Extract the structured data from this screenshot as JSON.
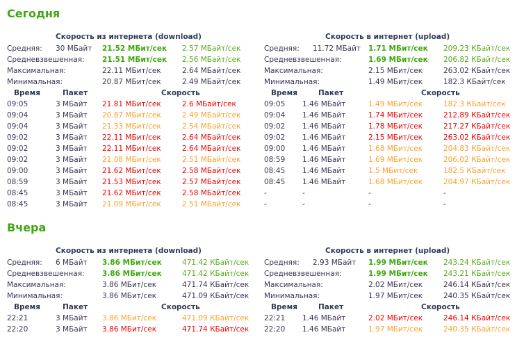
{
  "colors": {
    "title": "#3fa80f",
    "good": "#3fa80f",
    "red": "#f00000",
    "orange": "#f9a12a"
  },
  "days": [
    {
      "title": "Сегодня",
      "download": {
        "heading": "Скорость из интернета (download)",
        "stats": [
          {
            "label": "Средняя:",
            "size": "30 МБайт",
            "mbit": "21.52 МБит/сек",
            "bytes": "2.57 МБайт/сек",
            "style": "good"
          },
          {
            "label": "Средневзвешенная:",
            "size": "",
            "mbit": "21.51 МБит/сек",
            "bytes": "2.56 МБайт/сек",
            "style": "good"
          },
          {
            "label": "Максимальная:",
            "size": "",
            "mbit": "22.11 МБит/сек",
            "bytes": "2.64 МБайт/сек",
            "style": "plain"
          },
          {
            "label": "Минимальная:",
            "size": "",
            "mbit": "20.87 МБит/сек",
            "bytes": "2.49 МБайт/сек",
            "style": "plain"
          }
        ],
        "columns": {
          "time": "Время",
          "packet": "Пакет",
          "speed": "Скорость"
        },
        "rows": [
          {
            "time": "09:05",
            "packet": "3 МБайт",
            "mbit": "21.81 МБит/сек",
            "bytes": "2.6 МБайт/сек",
            "style": "red"
          },
          {
            "time": "09:04",
            "packet": "3 МБайт",
            "mbit": "20.87 МБит/сек",
            "bytes": "2.49 МБайт/сек",
            "style": "orange"
          },
          {
            "time": "09:04",
            "packet": "3 МБайт",
            "mbit": "21.33 МБит/сек",
            "bytes": "2.54 МБайт/сек",
            "style": "orange"
          },
          {
            "time": "09:02",
            "packet": "3 МБайт",
            "mbit": "22.11 МБит/сек",
            "bytes": "2.64 МБайт/сек",
            "style": "red"
          },
          {
            "time": "09:02",
            "packet": "3 МБайт",
            "mbit": "22.11 МБит/сек",
            "bytes": "2.64 МБайт/сек",
            "style": "red"
          },
          {
            "time": "09:02",
            "packet": "3 МБайт",
            "mbit": "21.08 МБит/сек",
            "bytes": "2.51 МБайт/сек",
            "style": "orange"
          },
          {
            "time": "09:00",
            "packet": "3 МБайт",
            "mbit": "21.62 МБит/сек",
            "bytes": "2.58 МБайт/сек",
            "style": "red"
          },
          {
            "time": "08:59",
            "packet": "3 МБайт",
            "mbit": "21.53 МБит/сек",
            "bytes": "2.57 МБайт/сек",
            "style": "red"
          },
          {
            "time": "08:45",
            "packet": "3 МБайт",
            "mbit": "21.62 МБит/сек",
            "bytes": "2.58 МБайт/сек",
            "style": "red"
          },
          {
            "time": "08:45",
            "packet": "3 МБайт",
            "mbit": "21.09 МБит/сек",
            "bytes": "2.51 МБайт/сек",
            "style": "orange"
          }
        ]
      },
      "upload": {
        "heading": "Скорость в интернет (upload)",
        "stats": [
          {
            "label": "Средняя:",
            "size": "11.72 МБайт",
            "mbit": "1.71 МБит/сек",
            "bytes": "209.23 КБайт/сек",
            "style": "good"
          },
          {
            "label": "Средневзвешенная:",
            "size": "",
            "mbit": "1.69 МБит/сек",
            "bytes": "206.82 КБайт/сек",
            "style": "good"
          },
          {
            "label": "Максимальная:",
            "size": "",
            "mbit": "2.15 МБит/сек",
            "bytes": "263.02 КБайт/сек",
            "style": "plain"
          },
          {
            "label": "Минимальная:",
            "size": "",
            "mbit": "1.49 МБит/сек",
            "bytes": "182.3 КБайт/сек",
            "style": "plain"
          }
        ],
        "columns": {
          "time": "Время",
          "packet": "Пакет",
          "speed": "Скорость"
        },
        "rows": [
          {
            "time": "09:05",
            "packet": "1.46 МБайт",
            "mbit": "1.49 МБит/сек",
            "bytes": "182.3 КБайт/сек",
            "style": "orange"
          },
          {
            "time": "09:04",
            "packet": "1.46 МБайт",
            "mbit": "1.74 МБит/сек",
            "bytes": "212.89 КБайт/сек",
            "style": "red"
          },
          {
            "time": "09:02",
            "packet": "1.46 МБайт",
            "mbit": "1.78 МБит/сек",
            "bytes": "217.27 КБайт/сек",
            "style": "red"
          },
          {
            "time": "09:02",
            "packet": "1.46 МБайт",
            "mbit": "2.15 МБит/сек",
            "bytes": "263.02 КБайт/сек",
            "style": "red"
          },
          {
            "time": "09:00",
            "packet": "1.46 МБайт",
            "mbit": "1.68 МБит/сек",
            "bytes": "204.83 КБайт/сек",
            "style": "orange"
          },
          {
            "time": "08:59",
            "packet": "1.46 МБайт",
            "mbit": "1.69 МБит/сек",
            "bytes": "206.02 КБайт/сек",
            "style": "orange"
          },
          {
            "time": "08:45",
            "packet": "1.46 МБайт",
            "mbit": "1.5 МБит/сек",
            "bytes": "182.5 КБайт/сек",
            "style": "orange"
          },
          {
            "time": "08:45",
            "packet": "1.46 МБайт",
            "mbit": "1.68 МБит/сек",
            "bytes": "204.97 КБайт/сек",
            "style": "orange"
          },
          {
            "time": "-",
            "packet": "-",
            "mbit": "-",
            "bytes": "-",
            "style": "plain"
          },
          {
            "time": "-",
            "packet": "-",
            "mbit": "-",
            "bytes": "-",
            "style": "plain"
          }
        ]
      }
    },
    {
      "title": "Вчера",
      "download": {
        "heading": "Скорость из интернета (download)",
        "stats": [
          {
            "label": "Средняя:",
            "size": "6 МБайт",
            "mbit": "3.86 МБит/сек",
            "bytes": "471.42 КБайт/сек",
            "style": "good"
          },
          {
            "label": "Средневзвешенная:",
            "size": "",
            "mbit": "3.86 МБит/сек",
            "bytes": "471.42 КБайт/сек",
            "style": "good"
          },
          {
            "label": "Максимальная:",
            "size": "",
            "mbit": "3.86 МБит/сек",
            "bytes": "471.74 КБайт/сек",
            "style": "plain"
          },
          {
            "label": "Минимальная:",
            "size": "",
            "mbit": "3.86 МБит/сек",
            "bytes": "471.09 КБайт/сек",
            "style": "plain"
          }
        ],
        "columns": {
          "time": "Время",
          "packet": "Пакет",
          "speed": "Скорость"
        },
        "rows": [
          {
            "time": "22:21",
            "packet": "3 МБайт",
            "mbit": "3.86 МБит/сек",
            "bytes": "471.09 КБайт/сек",
            "style": "orange"
          },
          {
            "time": "22:20",
            "packet": "3 МБайт",
            "mbit": "3.86 МБит/сек",
            "bytes": "471.74 КБайт/сек",
            "style": "red"
          }
        ]
      },
      "upload": {
        "heading": "Скорость в интернет (upload)",
        "stats": [
          {
            "label": "Средняя:",
            "size": "2.93 МБайт",
            "mbit": "1.99 МБит/сек",
            "bytes": "243.24 КБайт/сек",
            "style": "good"
          },
          {
            "label": "Средневзвешенная:",
            "size": "",
            "mbit": "1.99 МБит/сек",
            "bytes": "243.21 КБайт/сек",
            "style": "good"
          },
          {
            "label": "Максимальная:",
            "size": "",
            "mbit": "2.02 МБит/сек",
            "bytes": "246.14 КБайт/сек",
            "style": "plain"
          },
          {
            "label": "Минимальная:",
            "size": "",
            "mbit": "1.97 МБит/сек",
            "bytes": "240.35 КБайт/сек",
            "style": "plain"
          }
        ],
        "columns": {
          "time": "Время",
          "packet": "Пакет",
          "speed": "Скорость"
        },
        "rows": [
          {
            "time": "22:21",
            "packet": "1.46 МБайт",
            "mbit": "2.02 МБит/сек",
            "bytes": "246.14 КБайт/сек",
            "style": "red"
          },
          {
            "time": "22:20",
            "packet": "1.46 МБайт",
            "mbit": "1.97 МБит/сек",
            "bytes": "240.35 КБайт/сек",
            "style": "orange"
          }
        ]
      }
    }
  ]
}
